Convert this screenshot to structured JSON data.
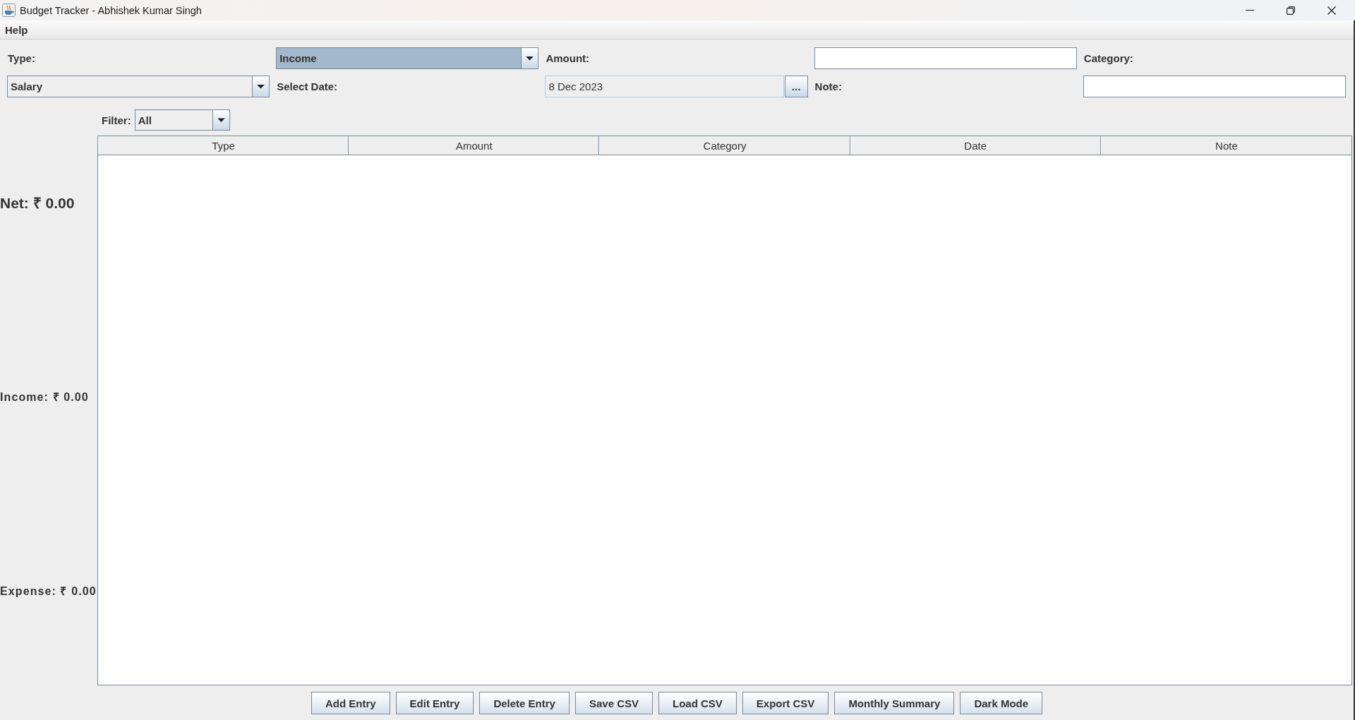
{
  "window": {
    "title": "Budget Tracker - Abhishek Kumar Singh"
  },
  "menu_bar": [
    "Help"
  ],
  "form": [
    {
      "kind": "label",
      "text": "Type:"
    },
    {
      "kind": "combo",
      "value": "Income",
      "focused": true
    },
    {
      "kind": "label",
      "text": "Amount:"
    },
    {
      "kind": "text"
    },
    {
      "kind": "label",
      "text": "Category:"
    },
    {
      "kind": "combo",
      "value": "Salary",
      "focused": false
    },
    {
      "kind": "label",
      "text": "Select Date:"
    },
    {
      "kind": "date",
      "value": "8 Dec 2023",
      "button": "..."
    },
    {
      "kind": "label",
      "text": "Note:"
    },
    {
      "kind": "text"
    }
  ],
  "filter": {
    "label": "Filter:",
    "value": "All",
    "focused": false
  },
  "summary": [
    {
      "kind": "net",
      "text": "Net: ₹ 0.00"
    },
    {
      "kind": "income",
      "text": "Income: ₹ 0.00"
    },
    {
      "kind": "expense",
      "text": "Expense: ₹ 0.00"
    }
  ],
  "table": {
    "columns": [
      "Type",
      "Amount",
      "Category",
      "Date",
      "Note"
    ]
  },
  "buttons": [
    "Add Entry",
    "Edit Entry",
    "Delete Entry",
    "Save CSV",
    "Load CSV",
    "Export CSV",
    "Monthly Summary",
    "Dark Mode"
  ]
}
